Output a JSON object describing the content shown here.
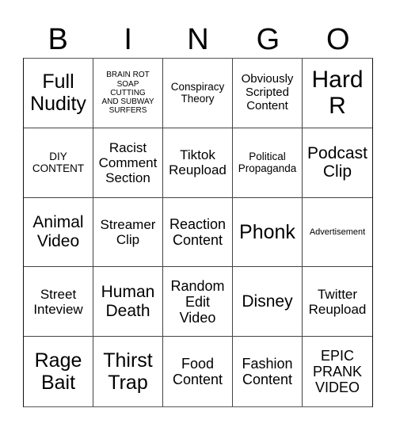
{
  "header": {
    "letters": [
      "B",
      "I",
      "N",
      "G",
      "O"
    ]
  },
  "cells": [
    {
      "text": "Full Nudity",
      "lines": [
        "Full",
        "Nudity"
      ],
      "size": "xxl"
    },
    {
      "text": "BRAIN ROT SOAP CUTTING AND SUBWAY SURFERS",
      "lines": [
        "BRAIN ROT",
        "SOAP",
        "CUTTING",
        "AND SUBWAY",
        "SURFERS"
      ],
      "size": "xs"
    },
    {
      "text": "Conspiracy Theory",
      "lines": [
        "Conspiracy",
        "Theory"
      ],
      "size": "md"
    },
    {
      "text": "Obviously Scripted Content",
      "lines": [
        "Obviously",
        "Scripted",
        "Content"
      ],
      "size": "mdl"
    },
    {
      "text": "Hard R",
      "lines": [
        "Hard",
        "R"
      ],
      "size": "big"
    },
    {
      "text": "DIY CONTENT",
      "lines": [
        "DIY",
        "CONTENT"
      ],
      "size": "md"
    },
    {
      "text": "Racist Comment Section",
      "lines": [
        "Racist",
        "Comment",
        "Section"
      ],
      "size": "lg"
    },
    {
      "text": "Tiktok Reupload",
      "lines": [
        "Tiktok",
        "Reupload"
      ],
      "size": "lg"
    },
    {
      "text": "Political Propaganda",
      "lines": [
        "Political",
        "Propaganda"
      ],
      "size": "md"
    },
    {
      "text": "Podcast Clip",
      "lines": [
        "Podcast",
        "Clip"
      ],
      "size": "xl"
    },
    {
      "text": "Animal Video",
      "lines": [
        "Animal",
        "Video"
      ],
      "size": "xl"
    },
    {
      "text": "Streamer Clip",
      "lines": [
        "Streamer",
        "Clip"
      ],
      "size": "lg"
    },
    {
      "text": "Reaction Content",
      "lines": [
        "Reaction",
        "Content"
      ],
      "size": "lg2"
    },
    {
      "text": "Phonk",
      "lines": [
        "Phonk"
      ],
      "size": "xxl"
    },
    {
      "text": "Advertisement",
      "lines": [
        "Advertisement"
      ],
      "size": "sm"
    },
    {
      "text": "Street Inteview",
      "lines": [
        "Street",
        "Inteview"
      ],
      "size": "lg"
    },
    {
      "text": "Human Death",
      "lines": [
        "Human",
        "Death"
      ],
      "size": "xl"
    },
    {
      "text": "Random Edit Video",
      "lines": [
        "Random",
        "Edit",
        "Video"
      ],
      "size": "lg2"
    },
    {
      "text": "Disney",
      "lines": [
        "Disney"
      ],
      "size": "xl"
    },
    {
      "text": "Twitter Reupload",
      "lines": [
        "Twitter",
        "Reupload"
      ],
      "size": "lg"
    },
    {
      "text": "Rage Bait",
      "lines": [
        "Rage",
        "Bait"
      ],
      "size": "xxl"
    },
    {
      "text": "Thirst Trap",
      "lines": [
        "Thirst",
        "Trap"
      ],
      "size": "xxl"
    },
    {
      "text": "Food Content",
      "lines": [
        "Food",
        "Content"
      ],
      "size": "lg2"
    },
    {
      "text": "Fashion Content",
      "lines": [
        "Fashion",
        "Content"
      ],
      "size": "lg2"
    },
    {
      "text": "EPIC PRANK VIDEO",
      "lines": [
        "EPIC",
        "PRANK",
        "VIDEO"
      ],
      "size": "lg2"
    }
  ]
}
